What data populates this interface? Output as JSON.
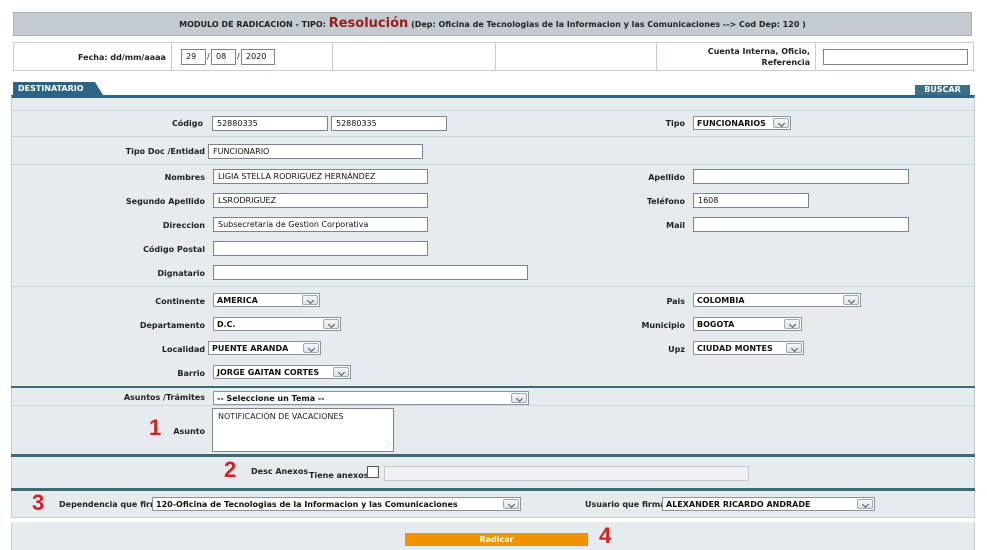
{
  "header": {
    "title_prefix": "MODULO DE RADICACION - TIPO:",
    "title_type": "Resolución",
    "title_suffix": "(Dep: Oficina de Tecnologias de la Informacion y las Comunicaciones --> Cod Dep: 120 )"
  },
  "date_row": {
    "fecha_label": "Fecha: dd/mm/aaaa",
    "day": "29",
    "month": "08",
    "year": "2020",
    "sep": "/",
    "cuenta_label_1": "Cuenta Interna, Oficio,",
    "cuenta_label_2": "Referencia",
    "cuenta_value": ""
  },
  "tabs": {
    "destinatario": "DESTINATARIO",
    "buscar": "BUSCAR"
  },
  "destinatario": {
    "codigo_label": "Código",
    "codigo_1": "52880335",
    "codigo_2": "52880335",
    "tipo_label": "Tipo",
    "tipo_value": "FUNCIONARIOS",
    "tipo_doc_label": "Tipo Doc /Entidad",
    "tipo_doc_value": "FUNCIONARIO",
    "nombres_label": "Nombres",
    "nombres_value": "LIGIA STELLA RODRIGUEZ HERNÁNDEZ",
    "apellido_label": "Apellido",
    "apellido_value": "",
    "segundo_apellido_label": "Segundo Apellido",
    "segundo_apellido_value": "LSRODRIGUEZ",
    "telefono_label": "Teléfono",
    "telefono_value": "1608",
    "direccion_label": "Direccion",
    "direccion_value": "Subsecretaria de Gestion Corporativa",
    "mail_label": "Mail",
    "mail_value": "",
    "codigo_postal_label": "Código Postal",
    "codigo_postal_value": "",
    "dignatario_label": "Dignatario",
    "dignatario_value": "",
    "continente_label": "Continente",
    "continente_value": "AMERICA",
    "pais_label": "Pais",
    "pais_value": "COLOMBIA",
    "departamento_label": "Departamento",
    "departamento_value": "D.C.",
    "municipio_label": "Municipio",
    "municipio_value": "BOGOTA",
    "localidad_label": "Localidad",
    "localidad_value": "PUENTE ARANDA",
    "upz_label": "Upz",
    "upz_value": "CIUDAD MONTES",
    "barrio_label": "Barrio",
    "barrio_value": "JORGE GAITAN CORTES"
  },
  "asuntos": {
    "tramites_label": "Asuntos /Trámites",
    "tramites_value": "-- Seleccione un Tema --",
    "asunto_label": "Asunto",
    "asunto_value": "NOTIFICACIÓN DE VACACIONES"
  },
  "anexos": {
    "desc_label": "Desc Anexos",
    "tiene_label": "Tiene anexos?",
    "desc_value": ""
  },
  "firma": {
    "dependencia_label": "Dependencia que firma",
    "dependencia_value": "120-Oficina de Tecnologias de la Informacion y las Comunicaciones",
    "usuario_label": "Usuario que firma",
    "usuario_value": "ALEXANDER RICARDO ANDRADE"
  },
  "actions": {
    "radicar_label": "Radicar"
  },
  "annotations": {
    "n1": "1",
    "n2": "2",
    "n3": "3",
    "n4": "4"
  },
  "colors": {
    "header_bg": "#c3cbd1",
    "panel_bg": "#e6ebee",
    "tab_blue": "#2d6483",
    "separator_teal": "#3c6b78",
    "radicar_orange": "#f39200",
    "annotation_red": "#d61f1f",
    "title_type_red": "#9b1c1c"
  }
}
